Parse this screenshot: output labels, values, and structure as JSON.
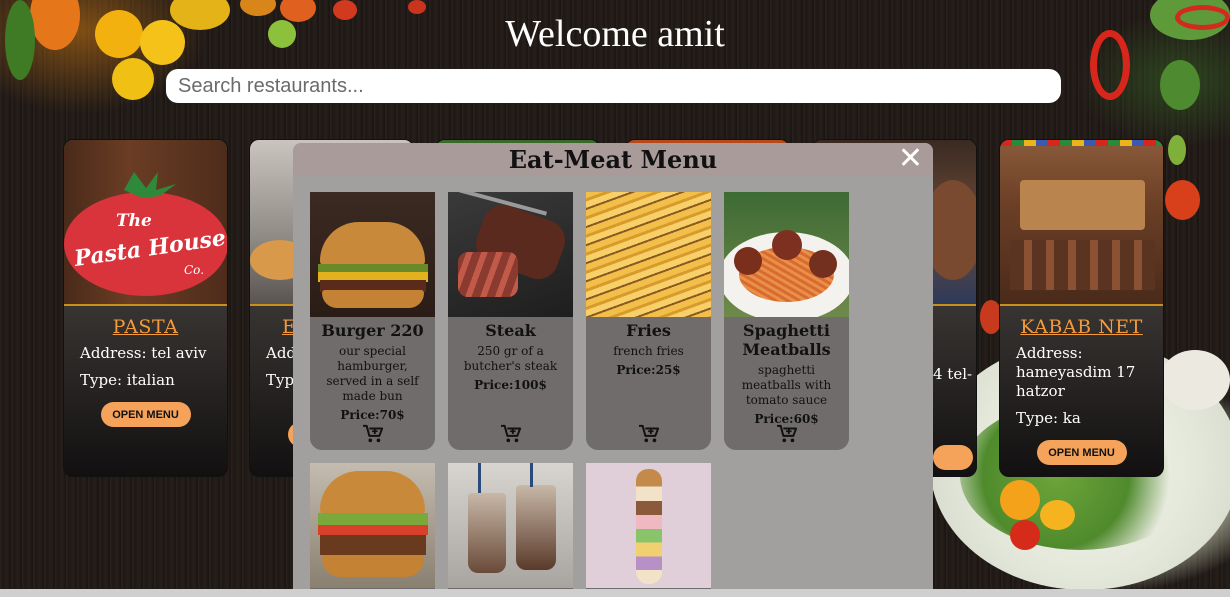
{
  "header": {
    "welcome": "Welcome amit",
    "search_placeholder": "Search restaurants..."
  },
  "restaurants": [
    {
      "name": "PASTA",
      "address": "Address: tel aviv",
      "type": "Type: italian",
      "button": "OPEN MENU"
    },
    {
      "name": "E",
      "address": "Add aviv",
      "type": "Type",
      "button": ""
    },
    {
      "name": "",
      "address": "4 tel-",
      "type": "",
      "button": ""
    },
    {
      "name": "KABAB NET",
      "address": "Address: hameyasdim 17 hatzor",
      "type": "Type: ka",
      "button": "OPEN MENU"
    }
  ],
  "logo": {
    "line1": "The",
    "line2": "Pasta House",
    "line3": "Co."
  },
  "modal": {
    "title": "Eat-Meat Menu",
    "close_label": "✕",
    "items": [
      {
        "name": "Burger 220",
        "description": "our special hamburger, served in a self made bun",
        "price": "Price:70$"
      },
      {
        "name": "Steak",
        "description": "250 gr of a butcher's steak",
        "price": "Price:100$"
      },
      {
        "name": "Fries",
        "description": "french fries",
        "price": "Price:25$"
      },
      {
        "name": "Spaghetti Meatballs",
        "description": "spaghetti meatballs with tomato sauce",
        "price": "Price:60$"
      }
    ]
  },
  "colors": {
    "accent_orange": "#f39a3c",
    "button_orange": "#f5a35a",
    "modal_bg": "#a29f9f",
    "item_bg": "#6f6c6b"
  },
  "icons": {
    "cart": "add-to-cart-icon",
    "close": "close-icon"
  }
}
